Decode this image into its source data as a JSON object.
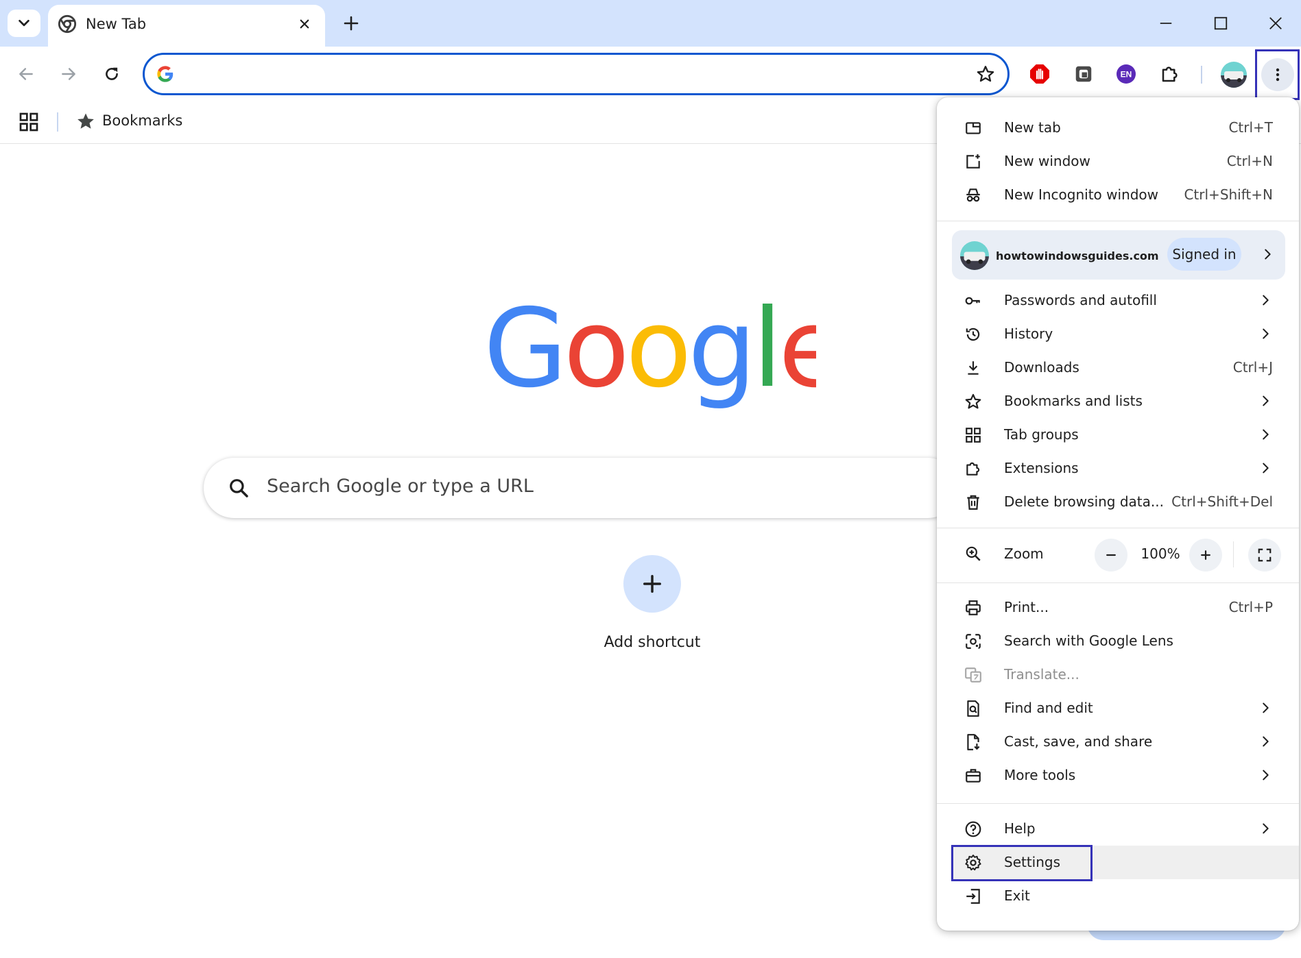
{
  "tab": {
    "title": "New Tab"
  },
  "bookmarks_bar": {
    "label": "Bookmarks"
  },
  "toolbar": {
    "extension_en_label": "EN"
  },
  "ntp": {
    "search_placeholder": "Search Google or type a URL",
    "shortcut_label": "Add shortcut"
  },
  "colors": {
    "accent": "#0b57d0",
    "highlight_box": "#3532b8",
    "tabstrip_bg": "#d3e3fd",
    "google_blue": "#4285f4",
    "google_red": "#ea4335",
    "google_yellow": "#fbbc05",
    "google_green": "#34a853"
  },
  "menu": {
    "group1": [
      {
        "icon": "new-tab-icon",
        "label": "New tab",
        "shortcut": "Ctrl+T"
      },
      {
        "icon": "new-window-icon",
        "label": "New window",
        "shortcut": "Ctrl+N"
      },
      {
        "icon": "incognito-icon",
        "label": "New Incognito window",
        "shortcut": "Ctrl+Shift+N"
      }
    ],
    "profile": {
      "name": "howtowindowsguides.com",
      "status": "Signed in"
    },
    "group2": [
      {
        "icon": "key-icon",
        "label": "Passwords and autofill",
        "shortcut": ""
      },
      {
        "icon": "history-icon",
        "label": "History",
        "shortcut": ""
      },
      {
        "icon": "download-icon",
        "label": "Downloads",
        "shortcut": "Ctrl+J"
      },
      {
        "icon": "star-icon",
        "label": "Bookmarks and lists",
        "shortcut": ""
      },
      {
        "icon": "tab-groups-icon",
        "label": "Tab groups",
        "shortcut": ""
      },
      {
        "icon": "puzzle-icon",
        "label": "Extensions",
        "shortcut": ""
      },
      {
        "icon": "trash-icon",
        "label": "Delete browsing data...",
        "shortcut": "Ctrl+Shift+Del"
      }
    ],
    "zoom": {
      "label": "Zoom",
      "value": "100%"
    },
    "group3": [
      {
        "icon": "print-icon",
        "label": "Print...",
        "shortcut": "Ctrl+P"
      },
      {
        "icon": "lens-icon",
        "label": "Search with Google Lens",
        "shortcut": ""
      },
      {
        "icon": "translate-icon",
        "label": "Translate...",
        "shortcut": ""
      },
      {
        "icon": "find-icon",
        "label": "Find and edit",
        "shortcut": ""
      },
      {
        "icon": "cast-icon",
        "label": "Cast, save, and share",
        "shortcut": ""
      },
      {
        "icon": "toolbox-icon",
        "label": "More tools",
        "shortcut": ""
      }
    ],
    "group4": [
      {
        "icon": "help-icon",
        "label": "Help",
        "shortcut": ""
      },
      {
        "icon": "gear-icon",
        "label": "Settings",
        "shortcut": ""
      },
      {
        "icon": "exit-icon",
        "label": "Exit",
        "shortcut": ""
      }
    ]
  }
}
